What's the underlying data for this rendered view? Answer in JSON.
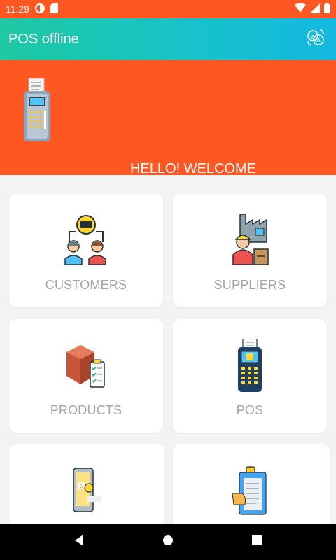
{
  "status_bar": {
    "time": "11:29"
  },
  "app_bar": {
    "title": "POS offline"
  },
  "banner": {
    "welcome": "HELLO! WELCOME"
  },
  "menu": {
    "items": [
      {
        "label": "CUSTOMERS",
        "icon": "customers-icon"
      },
      {
        "label": "SUPPLIERS",
        "icon": "suppliers-icon"
      },
      {
        "label": "PRODUCTS",
        "icon": "products-icon"
      },
      {
        "label": "POS",
        "icon": "pos-terminal-icon"
      },
      {
        "label": "",
        "icon": "mobile-payment-icon"
      },
      {
        "label": "",
        "icon": "clipboard-receipt-icon"
      }
    ]
  },
  "colors": {
    "primary": "#ff5722",
    "accent_start": "#1ec9a2",
    "accent_end": "#14b8e0",
    "label_gray": "#a5a5a5"
  }
}
